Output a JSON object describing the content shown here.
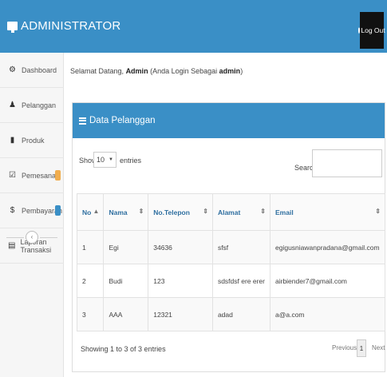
{
  "header": {
    "brand": "ADMINISTRATOR",
    "logout_label": "Log Out",
    "brand_icon": "desktop-icon",
    "accent": "#3a8fc6"
  },
  "sidebar": {
    "items": [
      {
        "label": "Dashboard",
        "icon": "dashboard-icon"
      },
      {
        "label": "Pelanggan",
        "icon": "user-icon"
      },
      {
        "label": "Produk",
        "icon": "bookmark-icon"
      },
      {
        "label": "Pemesanan",
        "icon": "check-square-icon",
        "badge_color": "#f0ad4e"
      },
      {
        "label": "Pembayaran",
        "icon": "dollar-icon",
        "badge_color": "#3a8fc6"
      },
      {
        "label": "Laporan Transaksi",
        "icon": "report-icon"
      }
    ],
    "toggle_icon": "chevron-left-icon"
  },
  "welcome": {
    "prefix": "Selamat Datang,",
    "user": "Admin",
    "middle": "(Anda Login Sebagai",
    "role": "admin",
    "suffix": ")"
  },
  "panel": {
    "title": "Data Pelanggan",
    "title_icon": "list-icon",
    "show_label": "Show",
    "length_value": "10",
    "entries_label": "entries",
    "search_label": "Search:",
    "search_value": ""
  },
  "table": {
    "columns": [
      "No",
      "Nama",
      "No.Telepon",
      "Alamat",
      "Email"
    ],
    "sort_icons": [
      "▲",
      "⇕",
      "⇕",
      "⇕",
      "⇕"
    ],
    "rows": [
      [
        "1",
        "Egi",
        "34636",
        "sfsf",
        "egigusniawanpradana@gmail.com"
      ],
      [
        "2",
        "Budi",
        "123",
        "sdsfdsf ere erer",
        "airbiender7@gmail.com"
      ],
      [
        "3",
        "AAA",
        "12321",
        "adad",
        "a@a.com"
      ]
    ]
  },
  "footer": {
    "info": "Showing 1 to 3 of 3 entries",
    "previous": "Previous",
    "current_page": "1",
    "next": "Next"
  }
}
